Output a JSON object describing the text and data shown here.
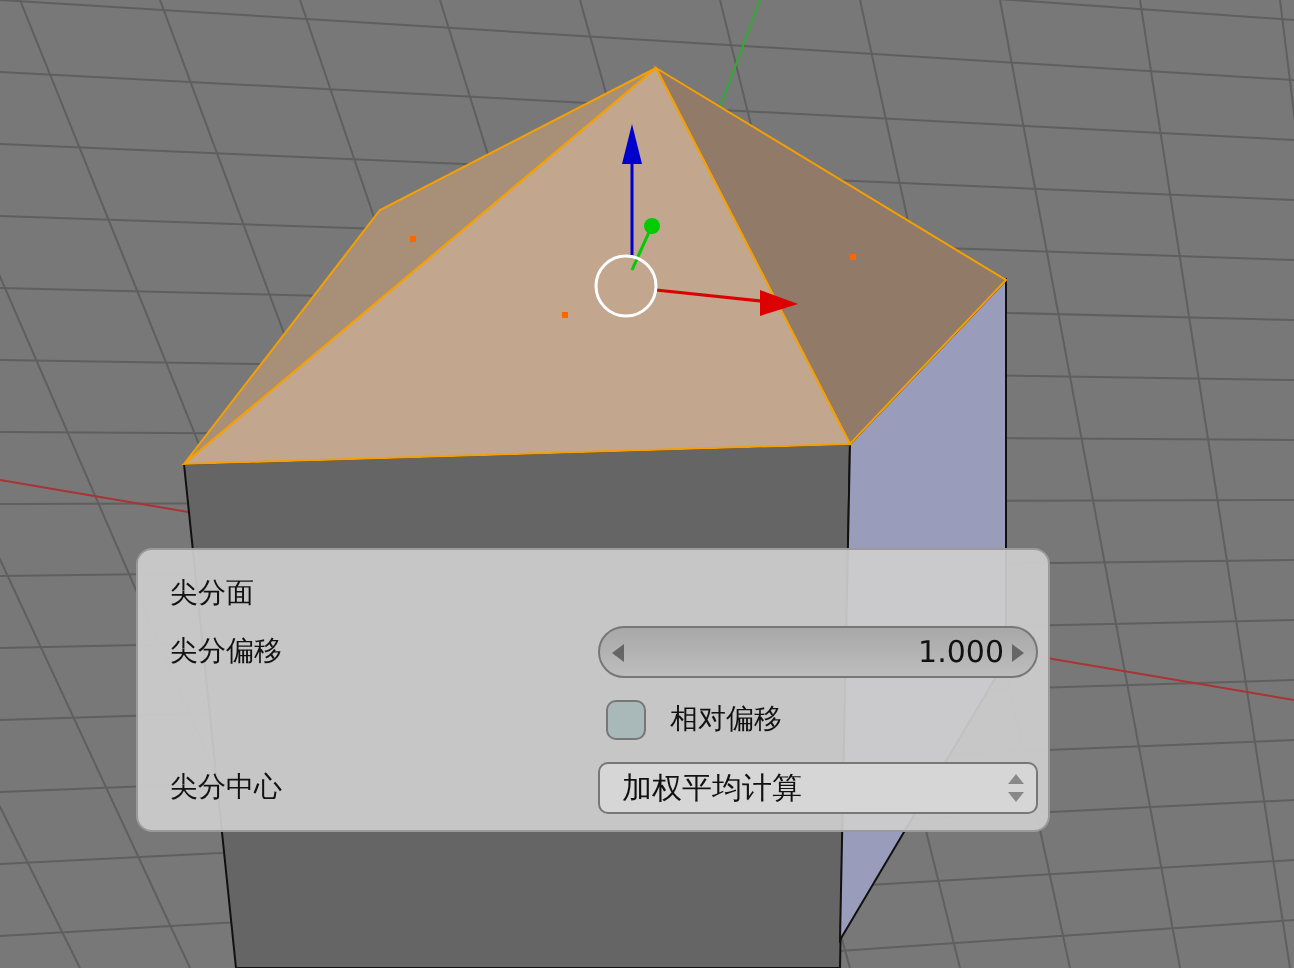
{
  "operator_panel": {
    "title": "尖分面",
    "offset": {
      "label": "尖分偏移",
      "value": "1.000"
    },
    "relative_offset": {
      "label": "相对偏移",
      "checked": false
    },
    "center": {
      "label": "尖分中心",
      "value": "加权平均计算"
    }
  }
}
